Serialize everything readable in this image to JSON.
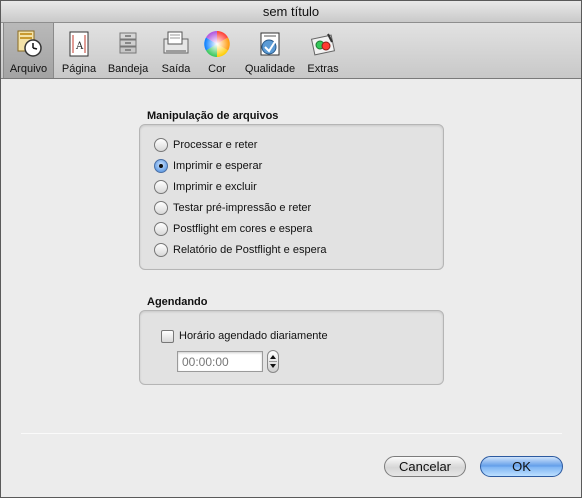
{
  "window": {
    "title": "sem título"
  },
  "toolbar": {
    "items": [
      {
        "label": "Arquivo",
        "icon": "clock-document-icon",
        "selected": true
      },
      {
        "label": "Página",
        "icon": "page-icon",
        "selected": false
      },
      {
        "label": "Bandeja",
        "icon": "tray-icon",
        "selected": false
      },
      {
        "label": "Saída",
        "icon": "output-icon",
        "selected": false
      },
      {
        "label": "Cor",
        "icon": "color-wheel-icon",
        "selected": false
      },
      {
        "label": "Qualidade",
        "icon": "quality-icon",
        "selected": false
      },
      {
        "label": "Extras",
        "icon": "extras-icon",
        "selected": false
      }
    ]
  },
  "file_handling": {
    "title": "Manipulação de arquivos",
    "options": [
      {
        "label": "Processar e reter",
        "checked": false
      },
      {
        "label": "Imprimir e esperar",
        "checked": true
      },
      {
        "label": "Imprimir e excluir",
        "checked": false
      },
      {
        "label": "Testar pré-impressão e reter",
        "checked": false
      },
      {
        "label": "Postflight em cores e espera",
        "checked": false
      },
      {
        "label": "Relatório de Postflight e espera",
        "checked": false
      }
    ]
  },
  "scheduling": {
    "title": "Agendando",
    "checkbox_label": "Horário agendado diariamente",
    "checkbox_checked": false,
    "time_value": "00:00:00"
  },
  "buttons": {
    "cancel": "Cancelar",
    "ok": "OK"
  },
  "colors": {
    "accent": "#5d9ae8",
    "window_bg": "#ececec"
  }
}
